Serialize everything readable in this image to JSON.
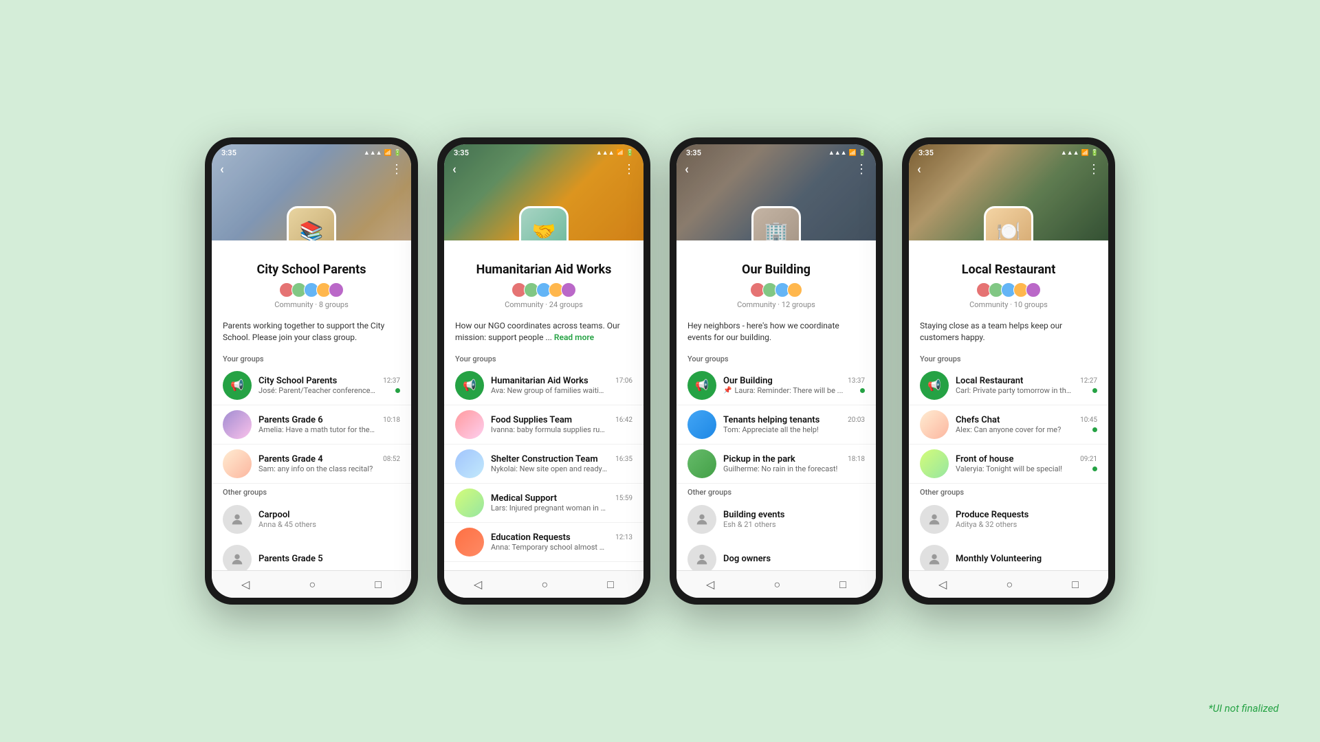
{
  "watermark": "*UI not finalized",
  "phones": [
    {
      "id": "school",
      "time": "3:35",
      "headerClass": "header-bg-school",
      "avatarClass": "group-avatar-school",
      "avatarEmoji": "📚",
      "communityName": "City School Parents",
      "memberCount": "8",
      "communityMeta": "Community · 8 groups",
      "description": "Parents working together to support the City School. Please join your class group.",
      "yourGroups": "Your groups",
      "groups": [
        {
          "name": "City School Parents",
          "time": "12:37",
          "msg": "José: Parent/Teacher conferences ...",
          "iconClass": "icon-green",
          "hasOnline": true,
          "hasPinned": false
        },
        {
          "name": "Parents Grade 6",
          "time": "10:18",
          "msg": "Amelia: Have a math tutor for the upco...",
          "iconClass": "icon-photo2",
          "hasOnline": false,
          "hasPinned": false
        },
        {
          "name": "Parents Grade 4",
          "time": "08:52",
          "msg": "Sam: any info on the class recital?",
          "iconClass": "icon-photo3",
          "hasOnline": false,
          "hasPinned": false
        }
      ],
      "otherGroupsLabel": "Other groups",
      "otherGroups": [
        {
          "name": "Carpool",
          "sub": "Anna & 45 others"
        },
        {
          "name": "Parents Grade 5",
          "sub": ""
        }
      ]
    },
    {
      "id": "humanitarian",
      "time": "3:35",
      "headerClass": "header-bg-humanitarian",
      "avatarClass": "group-avatar-humanitarian",
      "avatarEmoji": "🤝",
      "communityName": "Humanitarian Aid Works",
      "memberCount": "24",
      "communityMeta": "Community · 24 groups",
      "description": "How our NGO coordinates across teams. Our mission: support people ...",
      "readMore": "Read more",
      "yourGroups": "Your groups",
      "groups": [
        {
          "name": "Humanitarian Aid Works",
          "time": "17:06",
          "msg": "Ava: New group of families waiting ...",
          "iconClass": "icon-green",
          "hasOnline": false,
          "hasPinned": false
        },
        {
          "name": "Food Supplies Team",
          "time": "16:42",
          "msg": "Ivanna: baby formula supplies running ...",
          "iconClass": "icon-photo1",
          "hasOnline": false,
          "hasPinned": false
        },
        {
          "name": "Shelter Construction Team",
          "time": "16:35",
          "msg": "Nykolai: New site open and ready for ...",
          "iconClass": "icon-photo4",
          "hasOnline": false,
          "hasPinned": false
        },
        {
          "name": "Medical Support",
          "time": "15:59",
          "msg": "Lars: Injured pregnant woman in need ...",
          "iconClass": "icon-photo5",
          "hasOnline": false,
          "hasPinned": false
        },
        {
          "name": "Education Requests",
          "time": "12:13",
          "msg": "Anna: Temporary school almost comp...",
          "iconClass": "icon-photo6",
          "hasOnline": false,
          "hasPinned": false
        }
      ],
      "otherGroupsLabel": "",
      "otherGroups": []
    },
    {
      "id": "building",
      "time": "3:35",
      "headerClass": "header-bg-building",
      "avatarClass": "group-avatar-building",
      "avatarEmoji": "🏢",
      "communityName": "Our Building",
      "memberCount": "12",
      "communityMeta": "Community · 12 groups",
      "description": "Hey neighbors - here's how we coordinate events for our building.",
      "yourGroups": "Your groups",
      "groups": [
        {
          "name": "Our Building",
          "time": "13:37",
          "msg": "Laura: Reminder:  There will be ...",
          "iconClass": "icon-green",
          "hasOnline": true,
          "hasPinned": true
        },
        {
          "name": "Tenants helping tenants",
          "time": "20:03",
          "msg": "Tom: Appreciate all the help!",
          "iconClass": "icon-photo7",
          "hasOnline": false,
          "hasPinned": false
        },
        {
          "name": "Pickup in the park",
          "time": "18:18",
          "msg": "Guilherme: No rain in the forecast!",
          "iconClass": "icon-photo8",
          "hasOnline": false,
          "hasPinned": false
        }
      ],
      "otherGroupsLabel": "Other groups",
      "otherGroups": [
        {
          "name": "Building events",
          "sub": "Esh & 21 others"
        },
        {
          "name": "Dog owners",
          "sub": ""
        }
      ]
    },
    {
      "id": "restaurant",
      "time": "3:35",
      "headerClass": "header-bg-restaurant",
      "avatarClass": "group-avatar-restaurant",
      "avatarEmoji": "🍽️",
      "communityName": "Local Restaurant",
      "memberCount": "10",
      "communityMeta": "Community · 10 groups",
      "description": "Staying close as a team helps keep our customers happy.",
      "yourGroups": "Your groups",
      "groups": [
        {
          "name": "Local Restaurant",
          "time": "12:27",
          "msg": "Carl: Private party tomorrow in the ...",
          "iconClass": "icon-green",
          "hasOnline": true,
          "hasPinned": false
        },
        {
          "name": "Chefs Chat",
          "time": "10:45",
          "msg": "Alex: Can anyone cover for me?",
          "iconClass": "icon-photo3",
          "hasOnline": true,
          "hasPinned": false
        },
        {
          "name": "Front of house",
          "time": "09:21",
          "msg": "Valeryia: Tonight will be special!",
          "iconClass": "icon-photo5",
          "hasOnline": true,
          "hasPinned": false
        }
      ],
      "otherGroupsLabel": "Other groups",
      "otherGroups": [
        {
          "name": "Produce Requests",
          "sub": "Aditya & 32 others"
        },
        {
          "name": "Monthly Volunteering",
          "sub": ""
        }
      ]
    }
  ]
}
